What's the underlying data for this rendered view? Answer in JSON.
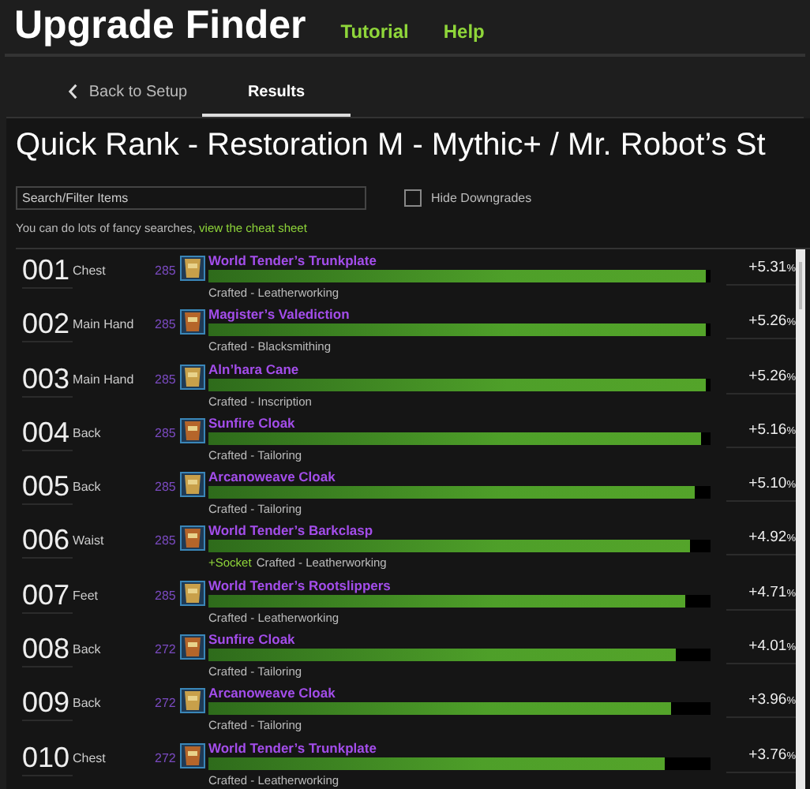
{
  "header": {
    "title": "Upgrade Finder",
    "links": [
      "Tutorial",
      "Help"
    ]
  },
  "tabs": [
    {
      "label": "Back to Setup",
      "selected": false,
      "back": true
    },
    {
      "label": "Results",
      "selected": true,
      "back": false
    }
  ],
  "heading": "Quick Rank - Restoration M - Mythic+ / Mr. Robot’s St",
  "search": {
    "placeholder": "Search/Filter Items"
  },
  "hide_downgrades": {
    "label": "Hide Downgrades",
    "checked": false
  },
  "hint": {
    "text": "You can do lots of fancy searches, ",
    "link": "view the cheat sheet"
  },
  "items": [
    {
      "rank": "001",
      "slot": "Chest",
      "ilvl": "285",
      "name": "World Tender’s Trunkplate",
      "source": "Crafted - Leatherworking",
      "level": 0.99,
      "gain": "+5.31",
      "unit": "%"
    },
    {
      "rank": "002",
      "slot": "Main Hand",
      "ilvl": "285",
      "name": "Magister’s Valediction",
      "source": "Crafted - Blacksmithing",
      "level": 0.99,
      "gain": "+5.26",
      "unit": "%"
    },
    {
      "rank": "003",
      "slot": "Main Hand",
      "ilvl": "285",
      "name": "Aln’hara Cane",
      "source": "Crafted - Inscription",
      "level": 0.99,
      "gain": "+5.26",
      "unit": "%"
    },
    {
      "rank": "004",
      "slot": "Back",
      "ilvl": "285",
      "name": "Sunfire Cloak",
      "source": "Crafted - Tailoring",
      "level": 0.98,
      "gain": "+5.16",
      "unit": "%"
    },
    {
      "rank": "005",
      "slot": "Back",
      "ilvl": "285",
      "name": "Arcanoweave Cloak",
      "source": "Crafted - Tailoring",
      "level": 0.97,
      "gain": "+5.10",
      "unit": "%"
    },
    {
      "rank": "006",
      "slot": "Waist",
      "ilvl": "285",
      "name": "World Tender’s Barkclasp",
      "extra": "+Socket",
      "source": "Crafted - Leatherworking",
      "level": 0.96,
      "gain": "+4.92",
      "unit": "%"
    },
    {
      "rank": "007",
      "slot": "Feet",
      "ilvl": "285",
      "name": "World Tender’s Rootslippers",
      "source": "Crafted - Leatherworking",
      "level": 0.95,
      "gain": "+4.71",
      "unit": "%"
    },
    {
      "rank": "008",
      "slot": "Back",
      "ilvl": "272",
      "name": "Sunfire Cloak",
      "source": "Crafted - Tailoring",
      "level": 0.93,
      "gain": "+4.01",
      "unit": "%"
    },
    {
      "rank": "009",
      "slot": "Back",
      "ilvl": "272",
      "name": "Arcanoweave Cloak",
      "source": "Crafted - Tailoring",
      "level": 0.92,
      "gain": "+3.96",
      "unit": "%"
    },
    {
      "rank": "010",
      "slot": "Chest",
      "ilvl": "272",
      "name": "World Tender’s Trunkplate",
      "source": "Crafted - Leatherworking",
      "level": 0.91,
      "gain": "+3.76",
      "unit": "%"
    }
  ]
}
